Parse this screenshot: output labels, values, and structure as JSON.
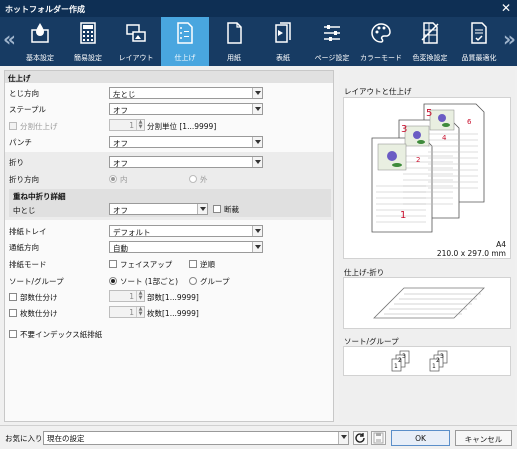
{
  "window": {
    "title": "ホットフォルダー作成",
    "close_glyph": "✕"
  },
  "toolbar": {
    "prev_glyph": "«",
    "next_glyph": "»",
    "items": [
      {
        "label": "基本設定",
        "icon": "droplet-icon"
      },
      {
        "label": "簡易設定",
        "icon": "calculator-icon"
      },
      {
        "label": "レイアウト",
        "icon": "layout-icon"
      },
      {
        "label": "仕上げ",
        "icon": "finishing-icon"
      },
      {
        "label": "用紙",
        "icon": "paper-icon"
      },
      {
        "label": "表紙",
        "icon": "cover-icon"
      },
      {
        "label": "ページ設定",
        "icon": "page-settings-icon"
      },
      {
        "label": "カラーモード",
        "icon": "palette-icon"
      },
      {
        "label": "色変換設定",
        "icon": "color-conversion-icon"
      },
      {
        "label": "品質最適化",
        "icon": "quality-icon"
      }
    ],
    "active_index": 3
  },
  "finishing": {
    "section_title": "仕上げ",
    "binding_direction": {
      "label": "とじ方向",
      "value": "左とじ"
    },
    "staple": {
      "label": "ステープル",
      "value": "オフ"
    },
    "split_finishing": {
      "label": "分割仕上げ",
      "checked": false,
      "enabled": false,
      "value": "1",
      "unit": "分割単位 [1...9999]"
    },
    "punch": {
      "label": "パンチ",
      "value": "オフ"
    },
    "fold": {
      "label": "折り",
      "value": "オフ"
    },
    "fold_direction": {
      "label": "折り方向",
      "options": [
        "内",
        "外"
      ],
      "selected": "内"
    },
    "saddle_detail": {
      "title": "重ね中折り詳細",
      "label": "中とじ",
      "value": "オフ",
      "trim_label": "断裁",
      "trim_checked": false
    },
    "output_tray": {
      "label": "排紙トレイ",
      "value": "デフォルト"
    },
    "paper_feed": {
      "label": "通紙方向",
      "value": "自動"
    },
    "output_mode": {
      "label": "排紙モード",
      "face_up": "フェイスアップ",
      "reverse": "逆順"
    },
    "sort_group": {
      "label": "ソート/グループ",
      "options": [
        "ソート (1部ごと)",
        "グループ"
      ],
      "selected": "ソート (1部ごと)"
    },
    "copy_split": {
      "label": "部数仕分け",
      "value": "1",
      "unit": "部数[1...9999]"
    },
    "sheet_split": {
      "label": "枚数仕分け",
      "value": "1",
      "unit": "枚数[1...9999]"
    },
    "no_index_output": {
      "label": "不要インデックス紙排紙"
    }
  },
  "preview": {
    "layout_title": "レイアウトと仕上げ",
    "paper_size": "A4",
    "paper_dims": "210.0 x 297.0 mm",
    "page_numbers": [
      "5",
      "6",
      "3",
      "4",
      "1",
      "2"
    ],
    "fold_title": "仕上げ-折り",
    "sort_title": "ソート/グループ",
    "sort_numbers": [
      "1",
      "2",
      "3",
      "1",
      "2",
      "3"
    ]
  },
  "footer": {
    "favorites_label": "お気に入り",
    "favorites_value": "現在の設定",
    "ok_label": "OK",
    "cancel_label": "キャンセル"
  },
  "colors": {
    "toolbar_bg": "#173b63",
    "title_bg": "#0e2f54",
    "active_tab": "#49a6df",
    "page_number_red": "#c8102e"
  }
}
